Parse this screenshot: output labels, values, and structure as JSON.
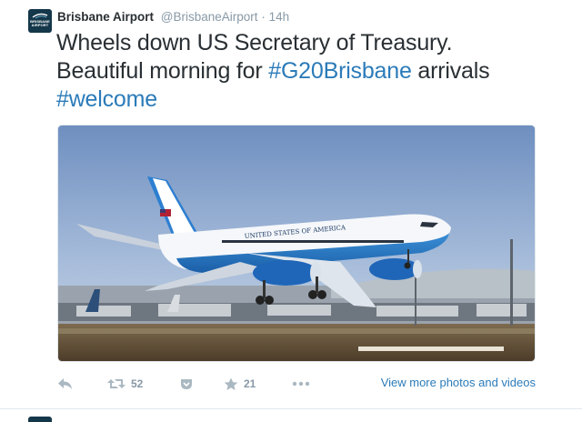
{
  "tweet": {
    "author_name": "Brisbane Airport",
    "author_handle": "@BrisbaneAirport",
    "separator": "·",
    "time": "14h",
    "avatar_text": "BRISBANE AIRPORT",
    "text_segments": {
      "line1": "Wheels down US Secretary of Treasury.",
      "line2_prefix": "Beautiful morning for ",
      "hashtag1": "#G20Brisbane",
      "line2_suffix": " arrivals",
      "hashtag2": "#welcome"
    },
    "media": {
      "description_icon": "photo-airplane",
      "fuselage_text": "UNITED STATES OF AMERICA"
    },
    "actions": {
      "reply_icon": "reply-icon",
      "retweet_icon": "retweet-icon",
      "retweet_count": "52",
      "save_icon": "pocket-icon",
      "favorite_icon": "star-icon",
      "favorite_count": "21",
      "more_icon": "ellipsis-icon",
      "view_more_label": "View more photos and videos"
    }
  },
  "colors": {
    "link": "#2b7bb9",
    "muted": "#8899a6",
    "text": "#292f33",
    "avatar_bg": "#14374a"
  }
}
